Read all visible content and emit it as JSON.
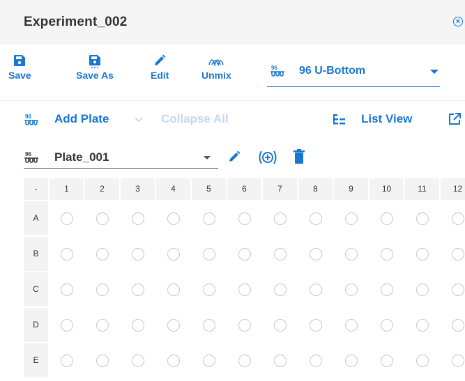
{
  "window": {
    "title": "Experiment_002",
    "close_icon": "close-circle-icon"
  },
  "toolbar": {
    "save_label": "Save",
    "save_as_label": "Save As",
    "edit_label": "Edit",
    "unmix_label": "Unmix",
    "plate_type_value": "96 U-Bottom",
    "plate_type_badge": "96"
  },
  "actions": {
    "add_plate_label": "Add Plate",
    "collapse_all_label": "Collapse All",
    "list_view_label": "List View"
  },
  "plate": {
    "name": "Plate_001",
    "badge": "96"
  },
  "grid": {
    "corner": "-",
    "columns": [
      "1",
      "2",
      "3",
      "4",
      "5",
      "6",
      "7",
      "8",
      "9",
      "10",
      "11",
      "12"
    ],
    "rows": [
      "A",
      "B",
      "C",
      "D",
      "E"
    ]
  },
  "colors": {
    "accent": "#1976d2",
    "header_bg": "#f3f3f3",
    "title_bg": "#f5f5f5",
    "well_border": "#c8c8c8"
  }
}
